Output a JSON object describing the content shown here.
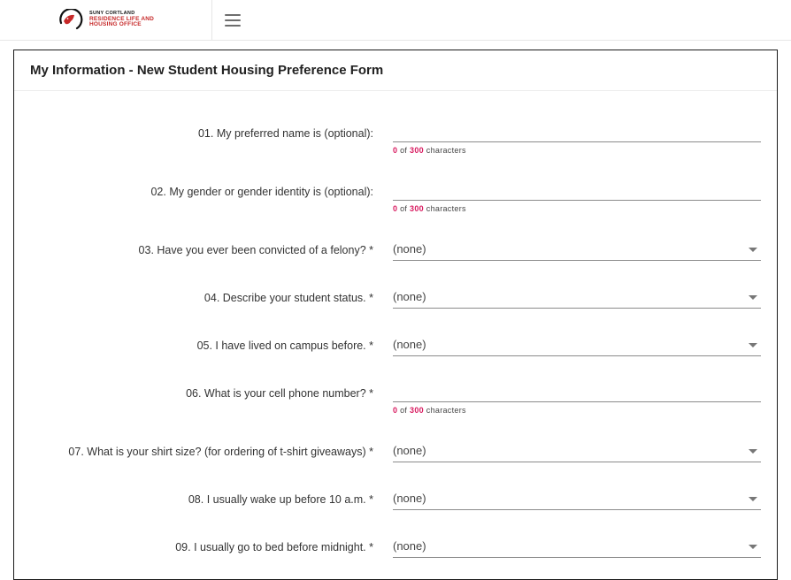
{
  "header": {
    "org_line1": "SUNY CORTLAND",
    "org_line2a": "RESIDENCE LIFE AND",
    "org_line2b": "HOUSING OFFICE"
  },
  "card": {
    "title": "My Information - New Student Housing Preference Form"
  },
  "counter": {
    "current": "0",
    "of": "of",
    "max": "300",
    "unit": "characters"
  },
  "none_text": "(none)",
  "fields": [
    {
      "label": "01. My preferred name is (optional):",
      "type": "text",
      "show_counter": true
    },
    {
      "label": "02. My gender or gender identity is (optional):",
      "type": "text",
      "show_counter": true
    },
    {
      "label": "03. Have you ever been convicted of a felony? *",
      "type": "select"
    },
    {
      "label": "04. Describe your student status. *",
      "type": "select"
    },
    {
      "label": "05. I have lived on campus before. *",
      "type": "select"
    },
    {
      "label": "06. What is your cell phone number? *",
      "type": "text",
      "show_counter": true
    },
    {
      "label": "07. What is your shirt size? (for ordering of t-shirt giveaways) *",
      "type": "select"
    },
    {
      "label": "08. I usually wake up before 10 a.m. *",
      "type": "select"
    },
    {
      "label": "09. I usually go to bed before midnight. *",
      "type": "select"
    }
  ]
}
